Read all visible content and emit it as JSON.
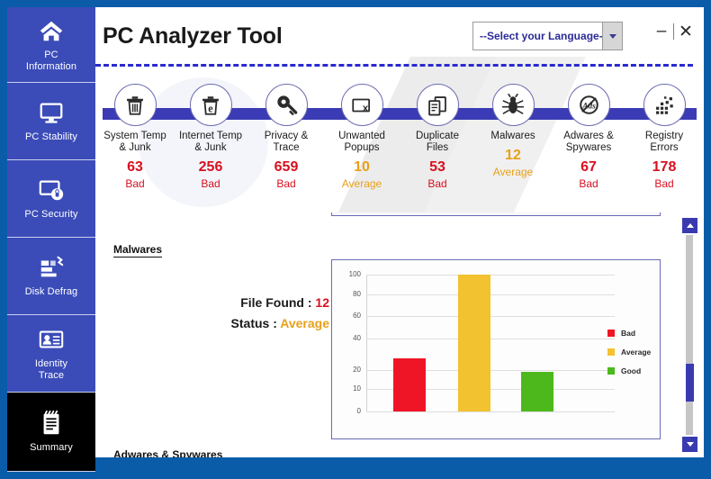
{
  "window": {
    "title": "PC Analyzer Tool",
    "minimize_label": "–",
    "close_label": "✕"
  },
  "language_select": {
    "selected": "--Select your Language--",
    "icon": "chevron-down-icon"
  },
  "sidebar": {
    "items": [
      {
        "label": "PC\nInformation",
        "icon": "home-icon",
        "active": false
      },
      {
        "label": "PC Stability",
        "icon": "monitor-icon",
        "active": false
      },
      {
        "label": "PC Security",
        "icon": "monitor-lock-icon",
        "active": false
      },
      {
        "label": "Disk Defrag",
        "icon": "disk-defrag-icon",
        "active": false
      },
      {
        "label": "Identity\nTrace",
        "icon": "id-card-icon",
        "active": false
      },
      {
        "label": "Summary",
        "icon": "clipboard-icon",
        "active": true
      }
    ]
  },
  "scan_nodes": [
    {
      "label": "System Temp\n& Junk",
      "icon": "trash-icon",
      "count": "63",
      "status": "Bad",
      "status_class": "c-bad"
    },
    {
      "label": "Internet Temp\n& Junk",
      "icon": "trash-ie-icon",
      "count": "256",
      "status": "Bad",
      "status_class": "c-bad"
    },
    {
      "label": "Privacy &\nTrace",
      "icon": "lock-key-icon",
      "count": "659",
      "status": "Bad",
      "status_class": "c-bad"
    },
    {
      "label": "Unwanted\nPopups",
      "icon": "popup-close-icon",
      "count": "10",
      "status": "Average",
      "status_class": "c-avg"
    },
    {
      "label": "Duplicate\nFiles",
      "icon": "duplicate-files-icon",
      "count": "53",
      "status": "Bad",
      "status_class": "c-bad"
    },
    {
      "label": "Malwares",
      "icon": "bug-icon",
      "count": "12",
      "status": "Average",
      "status_class": "c-avg"
    },
    {
      "label": "Adwares &\nSpywares",
      "icon": "no-ads-icon",
      "count": "67",
      "status": "Bad",
      "status_class": "c-bad"
    },
    {
      "label": "Registry\nErrors",
      "icon": "registry-icon",
      "count": "178",
      "status": "Bad",
      "status_class": "c-bad"
    }
  ],
  "section": {
    "title": "Malwares",
    "file_found_label": "File Found :",
    "file_found_value": "12",
    "status_label": "Status :",
    "status_value": "Average",
    "next_section_title": "Adwares & Spywares"
  },
  "scrollbar": {
    "up_icon": "scroll-up-arrow-icon",
    "down_icon": "scroll-down-arrow-icon"
  },
  "colors": {
    "bad": "#ef1526",
    "average": "#f2c230",
    "good": "#4cb81c",
    "frame_blue": "#0a5ca9",
    "sidebar_blue": "#3b4cb8",
    "strip_blue": "#3b3bb5",
    "accent_text": "#2b2b99"
  },
  "chart_data": {
    "type": "bar",
    "title": "",
    "xlabel": "",
    "ylabel": "",
    "categories": [
      "Bad",
      "Average",
      "Good"
    ],
    "values": [
      27,
      100,
      19
    ],
    "colors": [
      "#ef1526",
      "#f2c230",
      "#4cb81c"
    ],
    "ytick_labels": [
      "0",
      "10",
      "20",
      "40",
      "60",
      "80",
      "100"
    ],
    "ytick_values": [
      0,
      10,
      20,
      40,
      60,
      80,
      100
    ],
    "ylim": [
      0,
      100
    ],
    "grid": true,
    "legend_position": "right",
    "legend": [
      {
        "name": "Bad",
        "color": "#ef1526"
      },
      {
        "name": "Average",
        "color": "#f2c230"
      },
      {
        "name": "Good",
        "color": "#4cb81c"
      }
    ]
  }
}
